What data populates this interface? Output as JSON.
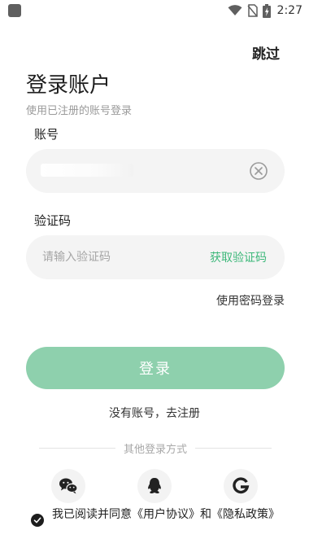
{
  "status_bar": {
    "time": "2:27",
    "icons": [
      "notification-icon",
      "wifi-icon",
      "no-sim-icon",
      "battery-charging-icon"
    ]
  },
  "header": {
    "skip_label": "跳过"
  },
  "page": {
    "title": "登录账户",
    "subtitle": "使用已注册的账号登录"
  },
  "account": {
    "label": "账号",
    "value_masked": true,
    "clear_icon": "clear-circle-icon"
  },
  "code": {
    "label": "验证码",
    "placeholder": "请输入验证码",
    "value": "",
    "get_code_label": "获取验证码"
  },
  "password_login_label": "使用密码登录",
  "login_button_label": "登录",
  "register_label": "没有账号，去注册",
  "other_login": {
    "divider_label": "其他登录方式",
    "providers": [
      {
        "icon": "wechat-icon"
      },
      {
        "icon": "qq-icon"
      },
      {
        "icon": "google-icon"
      }
    ]
  },
  "agreement": {
    "checked": true,
    "text": "我已阅读并同意《用户协议》和《隐私政策》"
  },
  "colors": {
    "accent": "#3db87a",
    "button": "#8ed0ad",
    "field_bg": "#f4f4f4"
  }
}
